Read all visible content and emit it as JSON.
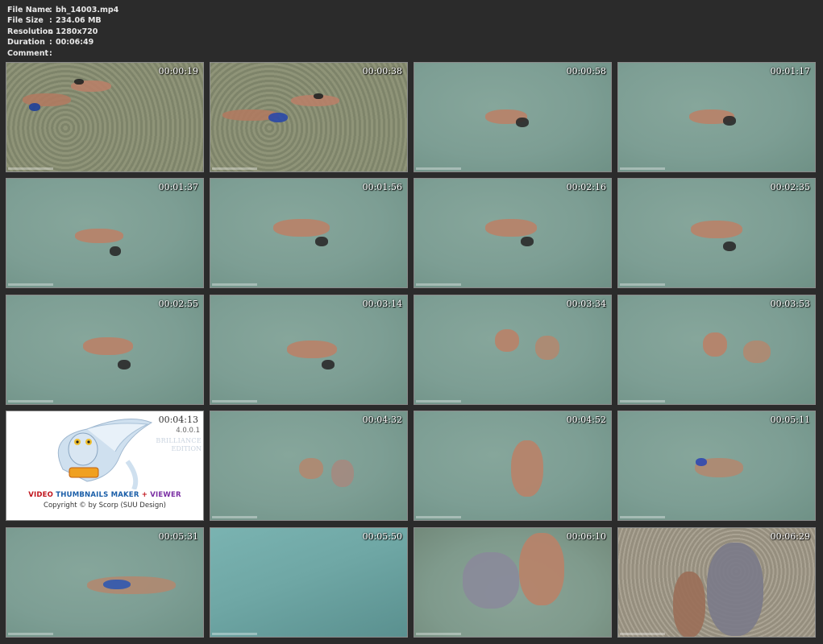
{
  "header": {
    "rows": [
      {
        "key": "File Name",
        "sep": ":",
        "value": "bh_14003.mp4"
      },
      {
        "key": "File Size",
        "sep": ":",
        "value": "234.06 MB"
      },
      {
        "key": "Resolution",
        "sep": ":",
        "value": "1280x720"
      },
      {
        "key": "Duration",
        "sep": ":",
        "value": "00:06:49"
      },
      {
        "key": "Comment",
        "sep": ":",
        "value": ""
      }
    ]
  },
  "thumbnails": [
    {
      "timestamp": "00:00:19",
      "scene": "shallow-rocky"
    },
    {
      "timestamp": "00:00:38",
      "scene": "shallow-rocky"
    },
    {
      "timestamp": "00:00:58",
      "scene": "water"
    },
    {
      "timestamp": "00:01:17",
      "scene": "water"
    },
    {
      "timestamp": "00:01:37",
      "scene": "water"
    },
    {
      "timestamp": "00:01:56",
      "scene": "water"
    },
    {
      "timestamp": "00:02:16",
      "scene": "water"
    },
    {
      "timestamp": "00:02:35",
      "scene": "water"
    },
    {
      "timestamp": "00:02:55",
      "scene": "water"
    },
    {
      "timestamp": "00:03:14",
      "scene": "water"
    },
    {
      "timestamp": "00:03:34",
      "scene": "water"
    },
    {
      "timestamp": "00:03:53",
      "scene": "water"
    },
    {
      "timestamp": "00:04:13",
      "scene": "logo"
    },
    {
      "timestamp": "00:04:32",
      "scene": "water"
    },
    {
      "timestamp": "00:04:52",
      "scene": "water"
    },
    {
      "timestamp": "00:05:11",
      "scene": "water"
    },
    {
      "timestamp": "00:05:31",
      "scene": "water"
    },
    {
      "timestamp": "00:05:50",
      "scene": "deep-water"
    },
    {
      "timestamp": "00:06:10",
      "scene": "shallow-water"
    },
    {
      "timestamp": "00:06:29",
      "scene": "beach"
    }
  ],
  "logo": {
    "version": "4.0.0.1",
    "edition_line1": "BRILLIANCE",
    "edition_line2": "EDITION",
    "brand_word1": "VIDEO",
    "brand_word2": "THUMBNAILS MAKER",
    "brand_plus": "+",
    "brand_word3": "VIEWER",
    "copyright": "Copyright © by Scorp (SUU Design)"
  },
  "colors": {
    "background": "#2b2b2b",
    "header_text": "#e8e8e8",
    "water": "#7d9e94",
    "shallow": "#8a8f74",
    "deep_water": "#6fa7a5",
    "beach": "#a39c8c",
    "brand_red": "#c0141c",
    "brand_blue": "#1a5ea8",
    "brand_purple": "#7a2ea3"
  }
}
